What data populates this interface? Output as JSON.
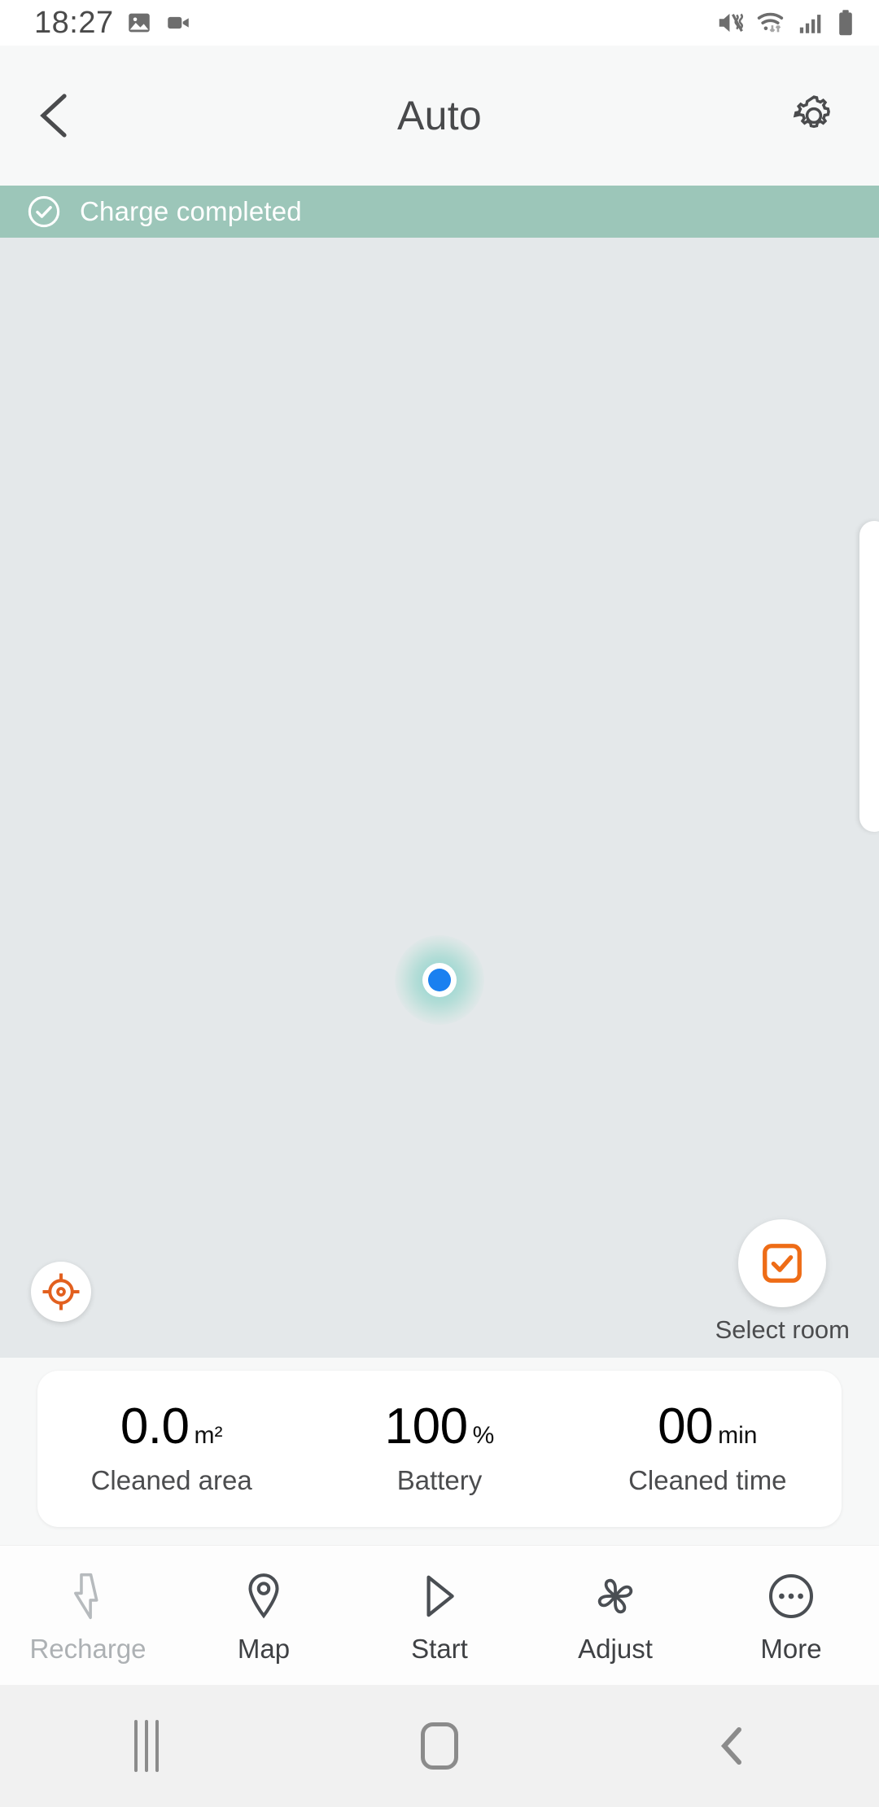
{
  "status_bar": {
    "time": "18:27",
    "left_icons": [
      "image-icon",
      "video-camera-icon"
    ],
    "right_icons": [
      "mute-vibrate-icon",
      "wifi-icon",
      "cellular-signal-icon",
      "battery-full-icon"
    ]
  },
  "header": {
    "back_icon": "chevron-left-icon",
    "title": "Auto",
    "settings_icon": "gear-icon"
  },
  "banner": {
    "icon": "check-circle-icon",
    "text": "Charge completed",
    "background_color": "#9cc6b9",
    "text_color": "#ffffff"
  },
  "map": {
    "background_color": "#e4e8ea",
    "robot_marker": {
      "name": "robot-position-marker",
      "core_color": "#1a80f0",
      "halo_color": "#8cd4c8"
    },
    "locate_button": {
      "icon": "crosshair-target-icon",
      "icon_color": "#e2601f"
    },
    "select_room_button": {
      "icon": "checkbox-checked-icon",
      "icon_color": "#ee6c16",
      "label": "Select room"
    },
    "drawer_peek": "room-list-drawer-handle"
  },
  "stats": [
    {
      "value": "0.0",
      "unit": "m²",
      "label": "Cleaned area"
    },
    {
      "value": "100",
      "unit": "%",
      "label": "Battery"
    },
    {
      "value": "00",
      "unit": "min",
      "label": "Cleaned time"
    }
  ],
  "toolbar": [
    {
      "label": "Recharge",
      "icon": "lightning-bolt-icon",
      "disabled": true
    },
    {
      "label": "Map",
      "icon": "map-pin-icon",
      "disabled": false
    },
    {
      "label": "Start",
      "icon": "play-triangle-icon",
      "disabled": false
    },
    {
      "label": "Adjust",
      "icon": "fan-blades-icon",
      "disabled": false
    },
    {
      "label": "More",
      "icon": "ellipsis-circle-icon",
      "disabled": false
    }
  ],
  "nav_bar": {
    "recents_icon": "recents-bars-icon",
    "home_icon": "home-square-icon",
    "back_icon": "chevron-left-icon"
  }
}
